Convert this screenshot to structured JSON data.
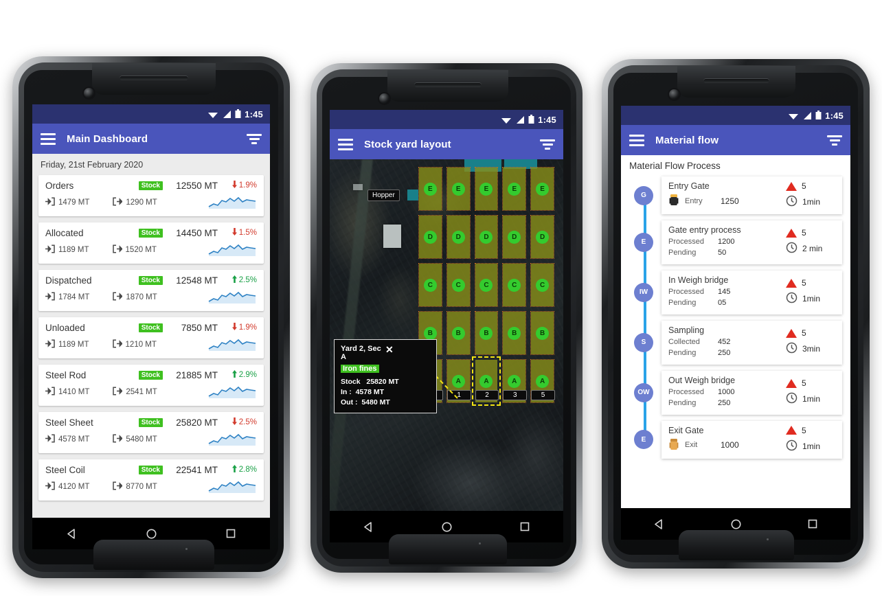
{
  "status_bar": {
    "time": "1:45",
    "icons": [
      "wifi-icon",
      "signal-icon",
      "battery-icon"
    ]
  },
  "colors": {
    "status_bar": "#2b3270",
    "app_bar": "#4a55bb",
    "badge_green": "#3fc020",
    "up_green": "#19a046",
    "down_red": "#d23a2c",
    "timeline_node": "#6d7fd0",
    "timeline_line": "#29a3e8",
    "alert_red": "#e02b20",
    "bay_green": "#34cb2e",
    "selection_yellow": "#f2e313"
  },
  "phone1": {
    "app_bar": {
      "title": "Main Dashboard",
      "menu_icon": "hamburger-icon",
      "filter_icon": "filter-icon"
    },
    "date": "Friday,  21st February  2020",
    "badge_label": "Stock",
    "unit": "MT",
    "items": [
      {
        "name": "Orders",
        "badge": "Stock",
        "stock": "12550 MT",
        "pct": "1.9%",
        "dir": "down",
        "in": "1479 MT",
        "out": "1290 MT"
      },
      {
        "name": "Allocated",
        "badge": "Stock",
        "stock": "14450 MT",
        "pct": "1.5%",
        "dir": "down",
        "in": "1189 MT",
        "out": "1520 MT"
      },
      {
        "name": "Dispatched",
        "badge": "Stock",
        "stock": "12548 MT",
        "pct": "2.5%",
        "dir": "up",
        "in": "1784 MT",
        "out": "1870 MT"
      },
      {
        "name": "Unloaded",
        "badge": "Stock",
        "stock": "7850 MT",
        "pct": "1.9%",
        "dir": "down",
        "in": "1189 MT",
        "out": "1210 MT"
      },
      {
        "name": "Steel Rod",
        "badge": "Stock",
        "stock": "21885 MT",
        "pct": "2.9%",
        "dir": "up",
        "in": "1410 MT",
        "out": "2541 MT"
      },
      {
        "name": "Steel Sheet",
        "badge": "Stock",
        "stock": "25820 MT",
        "pct": "2.5%",
        "dir": "down",
        "in": "4578 MT",
        "out": "5480 MT"
      },
      {
        "name": "Steel Coil",
        "badge": "Stock",
        "stock": "22541 MT",
        "pct": "2.8%",
        "dir": "up",
        "in": "4120 MT",
        "out": "8770 MT"
      }
    ]
  },
  "phone2": {
    "app_bar": {
      "title": "Stock yard layout",
      "menu_icon": "hamburger-icon",
      "filter_icon": "filter-icon"
    },
    "hopper_label": "Hopper",
    "row_labels": [
      "E",
      "D",
      "C",
      "B",
      "A"
    ],
    "column_numbers": [
      "4",
      "1",
      "2",
      "3",
      "5"
    ],
    "selected_cell": {
      "row": "A",
      "column": "2"
    },
    "tooltip": {
      "title": "Yard 2, Sec A",
      "close_icon": "close-icon",
      "material": "Iron fines",
      "stock_label": "Stock",
      "stock_value": "25820 MT",
      "in_label": "In :",
      "in_value": "4578 MT",
      "out_label": "Out :",
      "out_value": "5480 MT"
    }
  },
  "phone3": {
    "app_bar": {
      "title": "Material flow",
      "menu_icon": "hamburger-icon",
      "filter_icon": "filter-icon"
    },
    "section_title": "Material Flow Process",
    "steps": [
      {
        "node": "G",
        "title": "Entry Gate",
        "icon": "truck-icon",
        "icon_label": "Entry",
        "icon_value": "1250",
        "alert": "5",
        "time": "1min"
      },
      {
        "node": "E",
        "title": "Gate entry process",
        "k1": "Processed",
        "v1": "1200",
        "k2": "Pending",
        "v2": "50",
        "alert": "5",
        "time": "2 min"
      },
      {
        "node": "IW",
        "title": "In Weigh bridge",
        "k1": "Processed",
        "v1": "145",
        "k2": "Pending",
        "v2": "05",
        "alert": "5",
        "time": "1min"
      },
      {
        "node": "S",
        "title": "Sampling",
        "k1": "Collected",
        "v1": "452",
        "k2": "Pending",
        "v2": "250",
        "alert": "5",
        "time": "3min"
      },
      {
        "node": "OW",
        "title": "Out Weigh bridge",
        "k1": "Processed",
        "v1": "1000",
        "k2": "Pending",
        "v2": "250",
        "alert": "5",
        "time": "1min"
      },
      {
        "node": "E",
        "title": "Exit Gate",
        "icon": "truck-icon",
        "icon_label": "Exit",
        "icon_value": "1000",
        "alert": "5",
        "time": "1min"
      }
    ]
  },
  "nav_bar": {
    "back_icon": "back-triangle-icon",
    "home_icon": "home-circle-icon",
    "recents_icon": "recents-square-icon"
  }
}
